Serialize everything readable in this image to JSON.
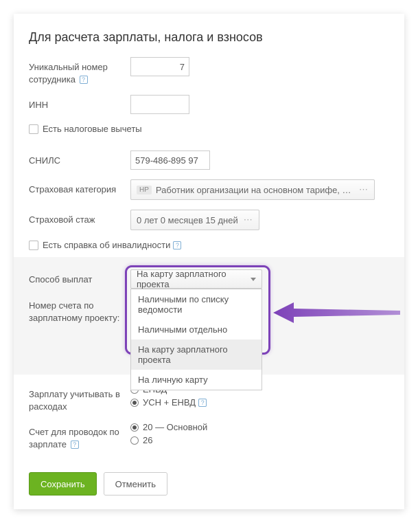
{
  "title": "Для расчета зарплаты, налога и взносов",
  "fields": {
    "employee_number": {
      "label": "Уникальный номер сотрудника",
      "value": "7"
    },
    "inn": {
      "label": "ИНН",
      "value": ""
    },
    "tax_deductions": {
      "label": "Есть налоговые вычеты"
    },
    "snils": {
      "label": "СНИЛС",
      "value": "579-486-895 97"
    },
    "insurance_category": {
      "label": "Страховая категория",
      "tag": "НР",
      "text": "Работник организации на основном тарифе, без льгот"
    },
    "insurance_period": {
      "label": "Страховой стаж",
      "text": "0 лет 0 месяцев 15 дней"
    },
    "disability": {
      "label": "Есть справка об инвалидности"
    },
    "payout_method": {
      "label": "Способ выплат",
      "selected": "На карту зарплатного проекта",
      "options": [
        "Наличными по списку ведомости",
        "Наличными отдельно",
        "На карту зарплатного проекта",
        "На личную карту"
      ]
    },
    "account_number": {
      "label": "Номер счета по зарплатному проекту:"
    },
    "expense_accounting": {
      "label": "Зарплату учитывать в расходах",
      "options": [
        "ЕНВД",
        "УСН + ЕНВД"
      ],
      "selected": "УСН + ЕНВД"
    },
    "posting_account": {
      "label": "Счет для проводок по зарплате",
      "options": [
        "20 — Основной",
        "26"
      ],
      "selected": "20 — Основной"
    }
  },
  "buttons": {
    "save": "Сохранить",
    "cancel": "Отменить"
  }
}
